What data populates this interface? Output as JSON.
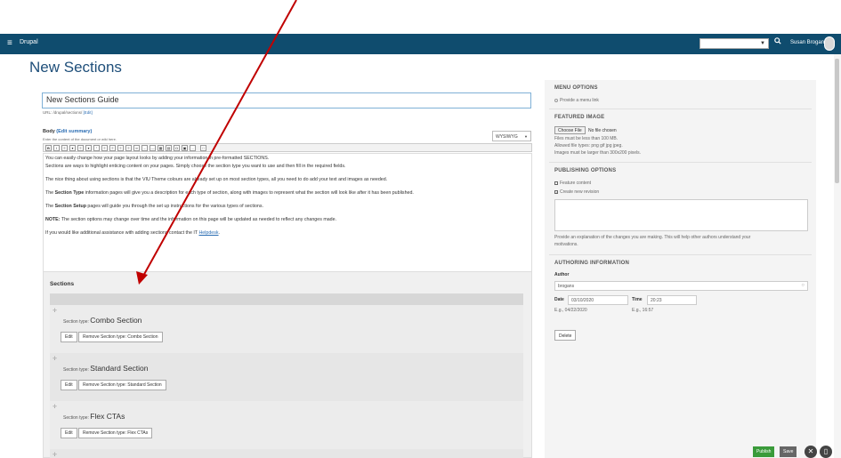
{
  "topbar": {
    "menu_icon": "≡",
    "brand": "Drupal",
    "search_icon": "🔍",
    "user_name": "Susan Brogan"
  },
  "page": {
    "title": "New Sections"
  },
  "form": {
    "title_value": "New Sections Guide",
    "url_label": "URL: /drupal/sections/",
    "url_edit": "[Edit]",
    "body_label": "Body",
    "edit_summary": "(Edit summary)",
    "body_hint": "Enter the content of the document or wiki here.",
    "format": "WYSIWYG"
  },
  "editor": {
    "p1_line1": "You can easily change how your page layout looks by adding your information in pre-formatted SECTIONS.",
    "p1_line2": "Sections are ways to highlight enticing content on your pages. Simply choose the section type you want to use and then fill in the required fields.",
    "p2": "The nice thing about using sections is that the VIU Theme colours are already set up on most section types, all you need to do add your text and images as needed.",
    "p3_bold": "Section Type",
    "p3_pre": "The ",
    "p3_post": " information pages will give you a description for each type of section, along with images to represent what the section will look like after it has been published.",
    "p4_pre": "The ",
    "p4_bold": "Section Setup",
    "p4_post": " pages will guide you through the set up instructions for the various types of sections.",
    "p5_bold": "NOTE:",
    "p5_post": " The section options may change over time and the information on this page will be updated as needed to reflect any changes made.",
    "p6_pre": "If you would like additional assistance with adding sections contact the IT ",
    "p6_link": "Helpdesk",
    "p6_post": "."
  },
  "sections": {
    "title": "Sections",
    "type_prefix": "Section type:",
    "edit_label": "Edit",
    "items": [
      {
        "type": "Combo Section",
        "remove": "Remove Section type: Combo Section"
      },
      {
        "type": "Standard Section",
        "remove": "Remove Section type: Standard Section"
      },
      {
        "type": "Flex CTAs",
        "remove": "Remove Section type: Flex CTAs"
      }
    ]
  },
  "sidebar": {
    "menu_options": "MENU OPTIONS",
    "provide_menu": "Provide a menu link",
    "featured_image": "FEATURED IMAGE",
    "choose_file": "Choose File",
    "no_file": "No file chosen",
    "file_rule1": "Files must be less than 100 MB.",
    "file_rule2": "Allowed file types: png gif jpg jpeg.",
    "file_rule3": "Images must be larger than 300x200 pixels.",
    "publishing_options": "PUBLISHING OPTIONS",
    "feature_content": "Feature content",
    "create_revision": "Create new revision",
    "revision_hint1": "Provide an explanation of the changes you are making. This will help other authors understand your",
    "revision_hint2": "motivations.",
    "authoring_info": "AUTHORING INFORMATION",
    "author_label": "Author",
    "author_value": "brogans",
    "date_label": "Date",
    "date_value": "03/10/2020",
    "time_label": "Time",
    "time_value": "20:23",
    "date_example": "E.g., 04/22/2020",
    "time_example": "E.g., 16:57",
    "delete": "Delete"
  },
  "footer": {
    "publish": "Publish",
    "save": "Save"
  },
  "colors": {
    "topbar": "#0f4c6e",
    "title": "#1f4f7a",
    "link": "#2a6db3",
    "publish": "#3a9b3a",
    "annotation_arrow": "#c00000"
  }
}
